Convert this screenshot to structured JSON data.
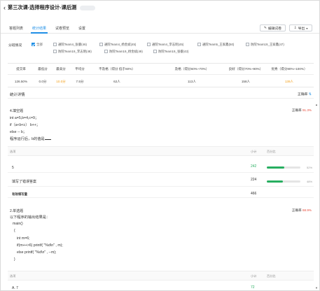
{
  "header": {
    "back_icon": "arrow-left-icon",
    "title": "第三次课-选择程序设计-课后测"
  },
  "tabs": [
    {
      "label": "答题列表"
    },
    {
      "label": "统计结果"
    },
    {
      "label": "试卷预览"
    },
    {
      "label": "设置"
    }
  ],
  "toolbar": {
    "edit_label": "编辑试卷",
    "export_label": "导出",
    "edit_icon": "edit-icon",
    "export_icon": "export-icon"
  },
  "filter": {
    "label": "分班情况",
    "options": [
      {
        "label": "全部",
        "checked": true
      },
      {
        "label": "通院Team4_张睿(46)",
        "checked": false
      },
      {
        "label": "通院Team4_杨金斌(45)",
        "checked": false
      },
      {
        "label": "通院Team4_李志明(45)",
        "checked": false
      },
      {
        "label": "通院Team5_王家鑫(50)",
        "checked": false
      },
      {
        "label": "防院Team19_王家鑫(47)",
        "checked": false
      },
      {
        "label": "防院Team19_李志明(48)",
        "checked": false
      },
      {
        "label": "防院Team19_杨金斌(49)",
        "checked": false
      },
      {
        "label": "防院Team19_张睿(43)",
        "checked": false
      }
    ]
  },
  "stats": {
    "headers": [
      "提交率",
      "最低分",
      "最高分",
      "平均分",
      "不及格（得分 低于60%）",
      "及格（得分60%~70%）",
      "良好（得分70%~90%）",
      "优秀（得分90%~100%）"
    ],
    "values": [
      "126.50%",
      "0.0分",
      "10.0分",
      "7.5分",
      "62人",
      "113人",
      "158人",
      "139人"
    ]
  },
  "detail": {
    "title": "统计详情",
    "sort_label": "正确率",
    "sort_icon": "sort-icon"
  },
  "columns": {
    "option": "选项",
    "count": "小计",
    "percent": "百分比"
  },
  "questions": [
    {
      "title": "4.填空题",
      "rate_label": "正确率",
      "rate_value": "91.3%",
      "lines": [
        "int a=5,b=4,c=9；",
        "if（a<b<c） b++；",
        "else -- b；",
        "程序运行后，b的值是"
      ],
      "rows": [
        {
          "option": "5",
          "count": "242",
          "percent_label": "52%",
          "fraction": 0.52
        },
        {
          "option": "填写了错误答案",
          "count": "224",
          "percent_label": "48%",
          "fraction": 0.48
        }
      ],
      "total_label": "有效填写量",
      "total_count": "466"
    },
    {
      "title": "2.单选题",
      "rate_label": "正确率",
      "rate_value": "68.9%",
      "lines": [
        "以下程序的输出结果是：",
        "main()",
        "{",
        "int m=6;",
        "if(m++>6)   printf( \"%d\\n\" , m);",
        "else printf( \"%d\\n\" , --m);",
        "}"
      ],
      "rows": [
        {
          "option": "A. 7",
          "count": "72"
        }
      ]
    }
  ]
}
